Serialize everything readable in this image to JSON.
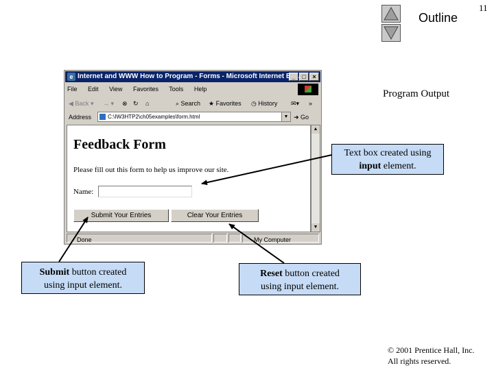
{
  "slide": {
    "page_number": "11",
    "outline_label": "Outline",
    "section_label": "Program Output",
    "copyright_line1": "© 2001 Prentice Hall, Inc.",
    "copyright_line2": "All rights reserved."
  },
  "browser": {
    "title": "Internet and WWW How to Program - Forms - Microsoft Internet Ex...",
    "window_buttons": [
      "_",
      "□",
      "×"
    ],
    "menu": [
      "File",
      "Edit",
      "View",
      "Favorites",
      "Tools",
      "Help"
    ],
    "toolbar": {
      "back": "Back",
      "forward": "→",
      "search": "Search",
      "favorites": "Favorites",
      "history": "History"
    },
    "address_label": "Address",
    "address_value": "C:\\IW3HTP2\\ch05examples\\form.html",
    "go_label": "Go",
    "status_text": "Done",
    "zone_text": "My Computer"
  },
  "form": {
    "heading": "Feedback Form",
    "intro": "Please fill out this form to help us improve our site.",
    "name_label": "Name:",
    "name_value": "",
    "submit_label": "Submit Your Entries",
    "reset_label": "Clear Your Entries"
  },
  "callouts": {
    "textbox_bold": "input",
    "textbox_line1": "Text box created using",
    "textbox_rest": " element.",
    "submit_bold": "Submit",
    "submit_rest": " button created",
    "submit_line2": "using input element.",
    "reset_bold": "Reset",
    "reset_rest": " button created",
    "reset_line2": "using input element."
  },
  "icons": {
    "nav_up": "triangle-up-icon",
    "nav_down": "triangle-down-icon"
  }
}
